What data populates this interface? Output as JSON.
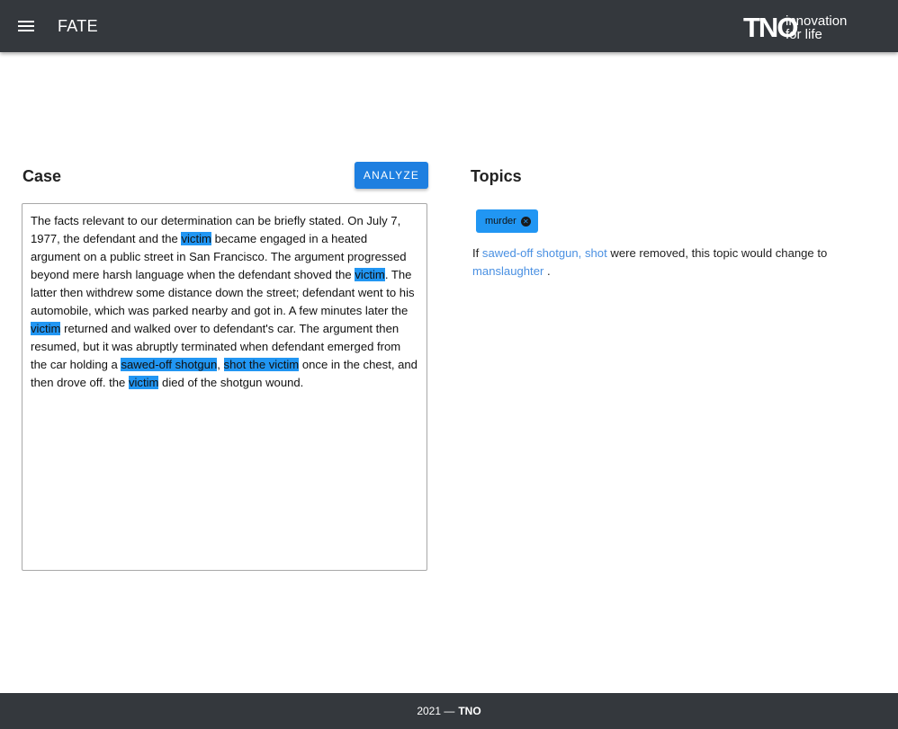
{
  "appbar": {
    "title": "FATE",
    "logo_wordmark": "TNO",
    "logo_line1": "innovation",
    "logo_line2": "for life"
  },
  "case": {
    "heading": "Case",
    "analyze_label": "ANALYZE",
    "segments": [
      {
        "t": "The facts relevant to our determination can be briefly stated. On July 7, 1977, the defendant and the ",
        "h": false
      },
      {
        "t": "victim",
        "h": true
      },
      {
        "t": " became engaged in a heated argument on a public street in San Francisco. The argument progressed beyond mere harsh language when the defendant shoved the ",
        "h": false
      },
      {
        "t": "victim",
        "h": true
      },
      {
        "t": ". The latter then withdrew some distance down the street; defendant went to his automobile, which was parked nearby and got in. A few minutes later the ",
        "h": false
      },
      {
        "t": "victim",
        "h": true
      },
      {
        "t": " returned and walked over to defendant's car. The argument then resumed, but it was abruptly terminated when defendant emerged from the car holding a ",
        "h": false
      },
      {
        "t": "sawed-off shotgun",
        "h": true
      },
      {
        "t": ", ",
        "h": false
      },
      {
        "t": "shot the victim",
        "h": true
      },
      {
        "t": " once in the chest, and then drove off. the ",
        "h": false
      },
      {
        "t": "victim",
        "h": true
      },
      {
        "t": " died of the shotgun wound.",
        "h": false
      }
    ]
  },
  "topics": {
    "heading": "Topics",
    "chip_label": "murder",
    "explanation": {
      "prefix": "If ",
      "link_terms": "sawed-off shotgun, shot",
      "middle": " were removed, this topic would change to",
      "link_topic": "manslaughter",
      "suffix": " ."
    }
  },
  "footer": {
    "year": "2021 —",
    "org": "TNO"
  },
  "colors": {
    "appbar": "#34383d",
    "accent": "#2196f3",
    "button": "#1e7fe0",
    "link": "#4a90e2"
  }
}
